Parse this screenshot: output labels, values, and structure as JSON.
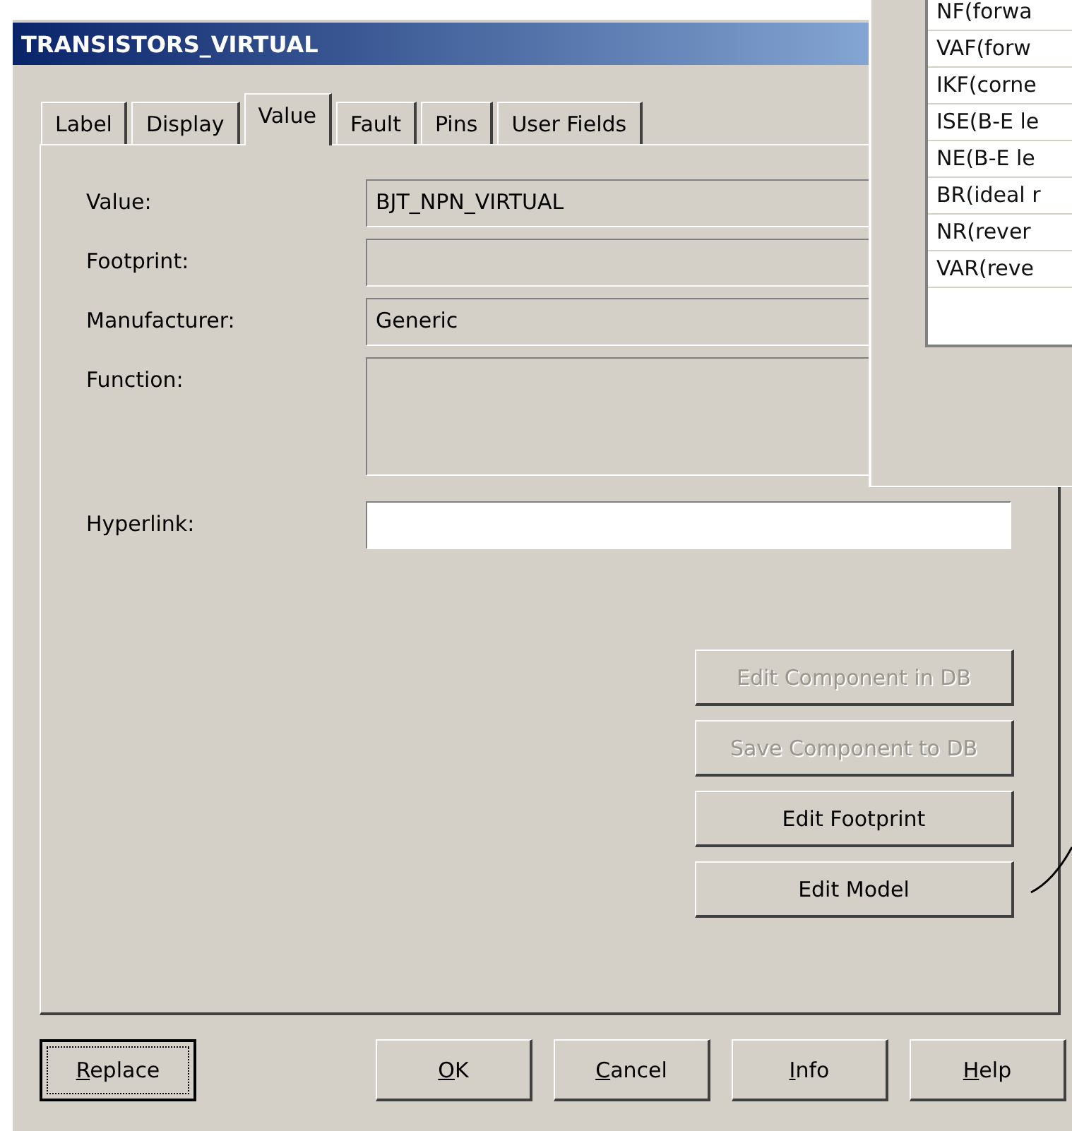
{
  "window": {
    "title": "TRANSISTORS_VIRTUAL"
  },
  "tabs": [
    {
      "label": "Label",
      "selected": false
    },
    {
      "label": "Display",
      "selected": false
    },
    {
      "label": "Value",
      "selected": true
    },
    {
      "label": "Fault",
      "selected": false
    },
    {
      "label": "Pins",
      "selected": false
    },
    {
      "label": "User Fields",
      "selected": false
    }
  ],
  "fields": [
    {
      "label": "Value:",
      "value": "BJT_NPN_VIRTUAL",
      "kind": "readonly"
    },
    {
      "label": "Footprint:",
      "kind": "readonly"
    },
    {
      "label": "Manufacturer:",
      "value": "Generic",
      "kind": "readonly"
    },
    {
      "label": "Function:",
      "kind": "multiline"
    },
    {
      "label": "Hyperlink:",
      "kind": "editable"
    }
  ],
  "side_buttons": [
    {
      "label": "Edit Component in DB",
      "disabled": true
    },
    {
      "label": "Save Component to DB",
      "disabled": true
    },
    {
      "label": "Edit Footprint",
      "disabled": false
    },
    {
      "label": "Edit Model",
      "disabled": false
    }
  ],
  "bottom_buttons": [
    {
      "label": "Replace",
      "focused": true,
      "mnemonic": true
    },
    {
      "label": "OK",
      "focused": false,
      "mnemonic": true
    },
    {
      "label": "Cancel",
      "focused": false,
      "mnemonic": true
    },
    {
      "label": "Info",
      "focused": false,
      "mnemonic": true
    },
    {
      "label": "Help",
      "focused": false,
      "mnemonic": true
    }
  ],
  "model_window": {
    "rows": [
      "NF(forwa",
      "VAF(forw",
      "IKF(corne",
      "ISE(B-E le",
      "NE(B-E le",
      "BR(ideal r",
      "NR(rever",
      "VAR(reve"
    ]
  }
}
